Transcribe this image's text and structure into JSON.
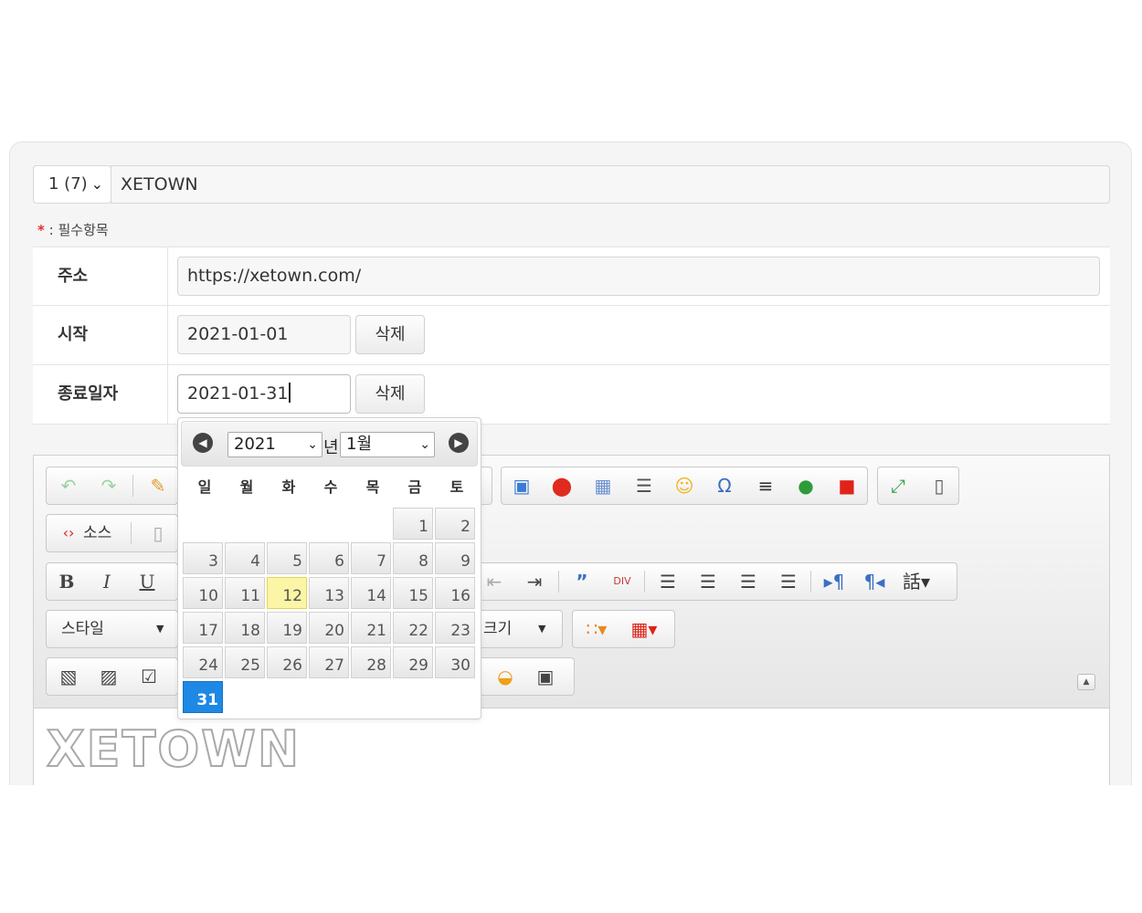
{
  "header": {
    "category_select": "1 (7)",
    "title_value": "XETOWN",
    "required_marker": "*",
    "required_text": ": 필수항목"
  },
  "form": {
    "url": {
      "label": "주소",
      "value": "https://xetown.com/"
    },
    "start": {
      "label": "시작",
      "value": "2021-01-01",
      "delete_label": "삭제"
    },
    "end": {
      "label": "종료일자",
      "value": "2021-01-31",
      "delete_label": "삭제"
    }
  },
  "datepicker": {
    "year": "2021",
    "year_suffix": "년",
    "month": "1월",
    "weekdays": [
      "일",
      "월",
      "화",
      "수",
      "목",
      "금",
      "토"
    ],
    "days": [
      "1",
      "2",
      "3",
      "4",
      "5",
      "6",
      "7",
      "8",
      "9",
      "10",
      "11",
      "12",
      "13",
      "14",
      "15",
      "16",
      "17",
      "18",
      "19",
      "20",
      "21",
      "22",
      "23",
      "24",
      "25",
      "26",
      "27",
      "28",
      "29",
      "30",
      "31"
    ],
    "today": "12",
    "selected": "31"
  },
  "editor": {
    "source_label": "소스",
    "bold": "B",
    "italic": "I",
    "underline": "U",
    "style_label": "스타일",
    "size_label": "크기",
    "content_logo": "XETOWN"
  },
  "colors": {
    "selected_day": "#1e88e5",
    "today_day": "#fbf5a5",
    "required_star": "#e03030"
  }
}
